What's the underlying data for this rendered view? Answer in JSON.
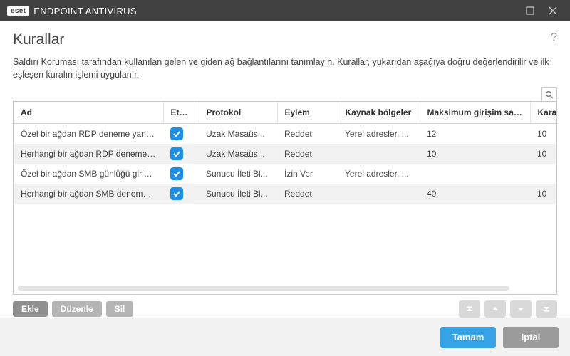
{
  "window": {
    "brand_tag": "eset",
    "brand_text": "ENDPOINT ANTIVIRUS"
  },
  "page": {
    "title": "Kurallar",
    "description": "Saldırı Koruması tarafından kullanılan gelen ve giden ağ bağlantılarını tanımlayın. Kurallar, yukarıdan aşağıya doğru değerlendirilir ve ilk eşleşen kuralın işlemi uygulanır."
  },
  "table": {
    "headers": {
      "name": "Ad",
      "active": "Etkin",
      "protocol": "Protokol",
      "action": "Eylem",
      "source": "Kaynak bölgeler",
      "max": "Maksimum girişim sayısı",
      "black": "Kara liste sakla"
    },
    "rows": [
      {
        "name": "Özel bir ağdan RDP deneme yanıl...",
        "active": true,
        "protocol": "Uzak Masaüs...",
        "action": "Reddet",
        "source": "Yerel adresler, ...",
        "max": "12",
        "black": "10"
      },
      {
        "name": "Herhangi bir ağdan RDP deneme y...",
        "active": true,
        "protocol": "Uzak Masaüs...",
        "action": "Reddet",
        "source": "",
        "max": "10",
        "black": "10"
      },
      {
        "name": "Özel bir ağdan SMB günlüğü girişi...",
        "active": true,
        "protocol": "Sunucu İleti Bl...",
        "action": "İzin Ver",
        "source": "Yerel adresler, ...",
        "max": "",
        "black": ""
      },
      {
        "name": "Herhangi bir ağdan SMB deneme y...",
        "active": true,
        "protocol": "Sunucu İleti Bl...",
        "action": "Reddet",
        "source": "",
        "max": "40",
        "black": "10"
      }
    ]
  },
  "toolbar": {
    "add": "Ekle",
    "edit": "Düzenle",
    "delete": "Sil"
  },
  "footer": {
    "ok": "Tamam",
    "cancel": "İptal"
  }
}
